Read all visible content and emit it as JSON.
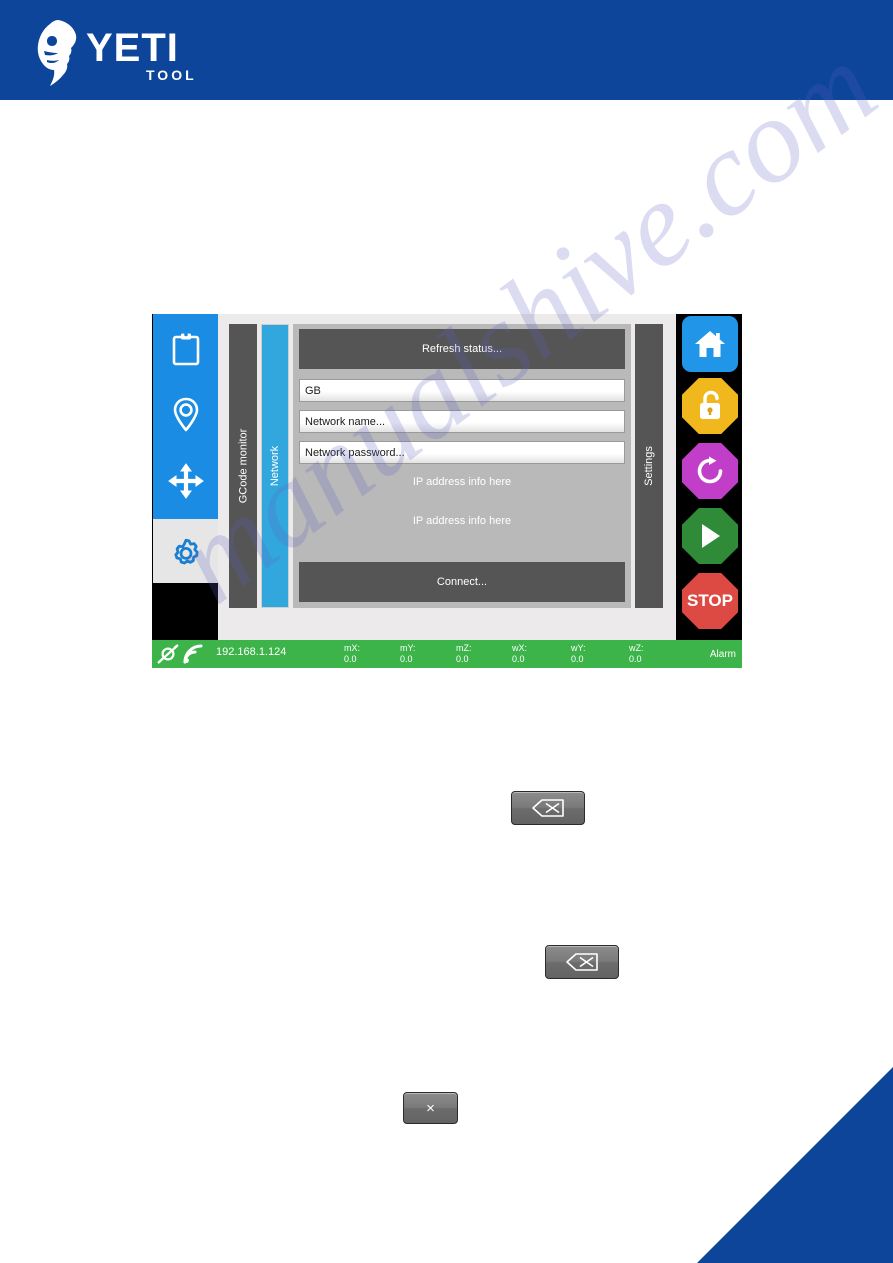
{
  "header": {
    "brand_name": "YETI",
    "brand_sub": "TOOL",
    "brand_color": "#0d459b",
    "logo_icon": "yeti-head-icon"
  },
  "device_screen": {
    "sidebar": {
      "items": [
        {
          "name": "clipboard",
          "icon": "clipboard-icon",
          "selected": false
        },
        {
          "name": "location",
          "icon": "location-pin-icon",
          "selected": false
        },
        {
          "name": "move",
          "icon": "move-arrows-icon",
          "selected": false
        },
        {
          "name": "settings",
          "icon": "gear-icon",
          "selected": true
        }
      ],
      "active_color": "#1b8ce3",
      "selected_bg": "#e6e6e6"
    },
    "tabs": [
      {
        "label": "GCode monitor",
        "active": false,
        "color": "#555555"
      },
      {
        "label": "Network",
        "active": true,
        "color": "#32a7dd"
      },
      {
        "label": "Settings",
        "active": false,
        "color": "#555555"
      }
    ],
    "network_panel": {
      "refresh_button": "Refresh status...",
      "country_field": "GB",
      "network_name_placeholder": "Network name...",
      "network_password_placeholder": "Network password...",
      "ip_info_line_1": "IP address info here",
      "ip_info_line_2": "IP address info here",
      "connect_button": "Connect..."
    },
    "action_buttons": [
      {
        "name": "home",
        "icon": "home-icon",
        "label": "",
        "color": "#2196e8",
        "shape": "rounded-square"
      },
      {
        "name": "unlock",
        "icon": "unlock-icon",
        "label": "",
        "color": "#f0b81c",
        "shape": "octagon"
      },
      {
        "name": "reset",
        "icon": "refresh-icon",
        "label": "",
        "color": "#c13fc8",
        "shape": "octagon"
      },
      {
        "name": "play",
        "icon": "play-icon",
        "label": "",
        "color": "#2f8b38",
        "shape": "octagon"
      },
      {
        "name": "stop",
        "icon": "stop-icon",
        "label": "STOP",
        "color": "#dd4a43",
        "shape": "octagon"
      }
    ],
    "status_bar": {
      "background": "#3cb44a",
      "plug_icon": "plug-icon",
      "wifi_icon": "wifi-icon",
      "ip_address": "192.168.1.124",
      "coordinates": [
        {
          "label": "mX:",
          "value": "0.0"
        },
        {
          "label": "mY:",
          "value": "0.0"
        },
        {
          "label": "mZ:",
          "value": "0.0"
        },
        {
          "label": "wX:",
          "value": "0.0"
        },
        {
          "label": "wY:",
          "value": "0.0"
        },
        {
          "label": "wZ:",
          "value": "0.0"
        }
      ],
      "state": "Alarm"
    }
  },
  "inline_keys": [
    {
      "name": "backspace-key-1",
      "icon": "backspace-icon",
      "label": ""
    },
    {
      "name": "backspace-key-2",
      "icon": "backspace-icon",
      "label": ""
    },
    {
      "name": "close-key",
      "icon": "close-icon",
      "label": "×"
    }
  ],
  "watermark": {
    "text": "manualshive.com"
  }
}
